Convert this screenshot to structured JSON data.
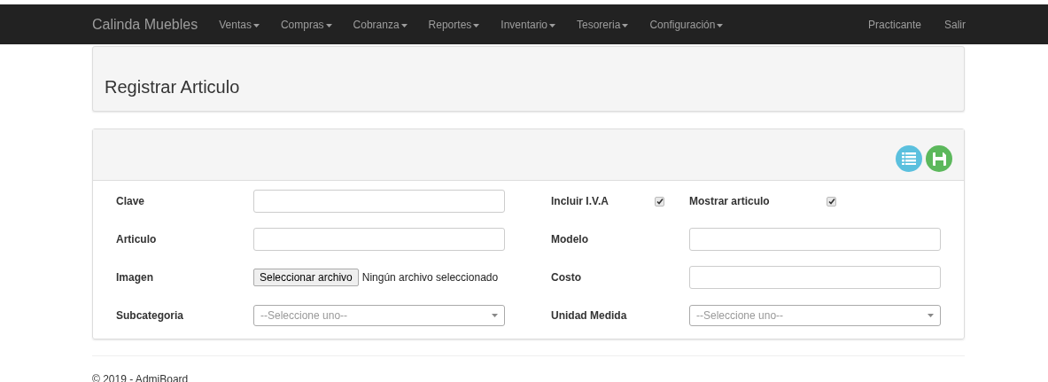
{
  "navbar": {
    "brand": "Calinda Muebles",
    "menus": [
      {
        "label": "Ventas"
      },
      {
        "label": "Compras"
      },
      {
        "label": "Cobranza"
      },
      {
        "label": "Reportes"
      },
      {
        "label": "Inventario"
      },
      {
        "label": "Tesoreria"
      },
      {
        "label": "Configuración"
      }
    ],
    "right_links": [
      "Practicante",
      "Salir"
    ]
  },
  "page_title": "Registrar Articulo",
  "form": {
    "rows": [
      {
        "left": {
          "kind": "text",
          "label": "Clave"
        },
        "right": [
          {
            "kind": "checkbox",
            "label": "Incluir I.V.A",
            "checked": true
          },
          {
            "kind": "checkbox",
            "label": "Mostrar articulo",
            "checked": true
          }
        ]
      },
      {
        "left": {
          "kind": "text",
          "label": "Articulo"
        },
        "right": [
          {
            "kind": "text",
            "label": "Modelo"
          }
        ]
      },
      {
        "left": {
          "kind": "file",
          "label": "Imagen",
          "button": "Seleccionar archivo",
          "status": "Ningún archivo seleccionado"
        },
        "right": [
          {
            "kind": "text",
            "label": "Costo"
          }
        ]
      },
      {
        "left": {
          "kind": "select",
          "label": "Subcategoria",
          "value": "--Seleccione uno--"
        },
        "right": [
          {
            "kind": "select",
            "label": "Unidad Medida",
            "value": "--Seleccione uno--"
          }
        ]
      }
    ]
  },
  "footer": "© 2019 - AdmiBoard"
}
